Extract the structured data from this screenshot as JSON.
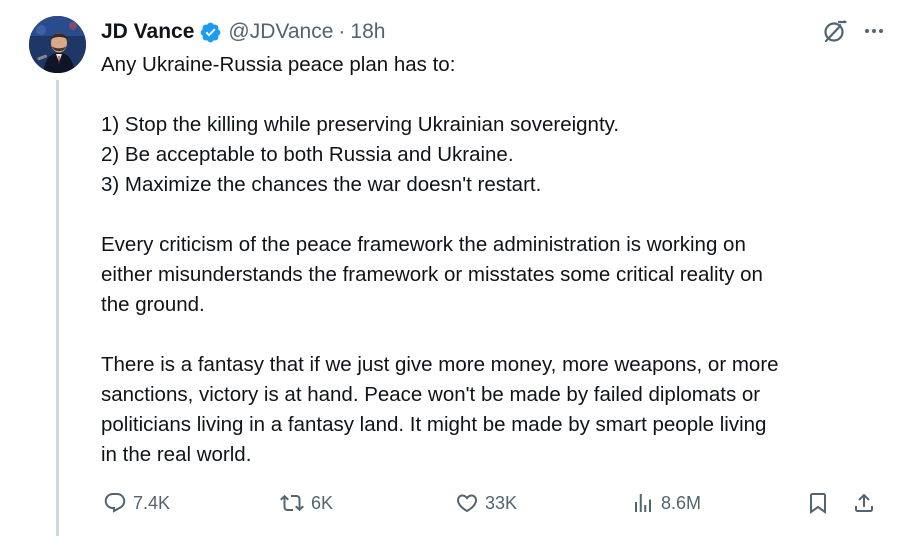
{
  "author": {
    "display_name": "JD Vance",
    "handle": "@JDVance",
    "separator": "·",
    "time": "18h",
    "verified": true
  },
  "tweet": {
    "paragraphs": [
      [
        "Any Ukraine-Russia peace plan has to:"
      ],
      [
        "1) Stop the killing while preserving Ukrainian sovereignty.",
        "2) Be acceptable to both Russia and Ukraine.",
        "3) Maximize the chances the war doesn't restart."
      ],
      [
        "Every criticism of the peace framework the administration is working on",
        "either misunderstands the framework or misstates some critical reality on",
        "the ground."
      ],
      [
        "There is a fantasy that if we just give more money, more weapons, or more",
        "sanctions, victory is at hand. Peace won't be made by failed diplomats or",
        "politicians living in a fantasy land. It might be made by smart people living",
        "in the real world."
      ]
    ]
  },
  "actions": {
    "replies": "7.4K",
    "reposts": "6K",
    "likes": "33K",
    "views": "8.6M"
  },
  "icons": {
    "top": [
      "grok-icon",
      "more-icon"
    ],
    "bottom": [
      "reply-icon",
      "repost-icon",
      "like-icon",
      "views-icon",
      "bookmark-icon",
      "share-icon"
    ]
  },
  "colors": {
    "text": "#0f1419",
    "secondary": "#536471",
    "verified_blue": "#1d9bf0",
    "thread_line": "#cfd9de"
  }
}
